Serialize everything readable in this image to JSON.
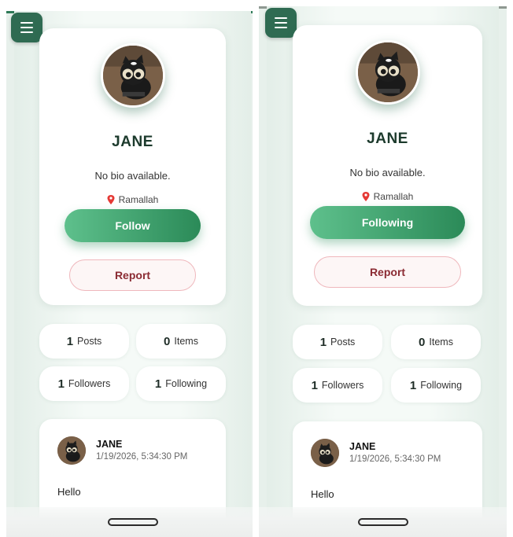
{
  "screens": [
    {
      "profile": {
        "name": "JANE",
        "bio": "No bio available.",
        "location": "Ramallah",
        "follow_label": "Follow",
        "report_label": "Report"
      },
      "stats": {
        "posts": {
          "value": "1",
          "label": "Posts"
        },
        "items": {
          "value": "0",
          "label": "Items"
        },
        "followers": {
          "value": "1",
          "label": "Followers"
        },
        "following": {
          "value": "1",
          "label": "Following"
        }
      },
      "post": {
        "author": "JANE",
        "timestamp": "1/19/2026, 5:34:30 PM",
        "text": "Hello"
      }
    },
    {
      "profile": {
        "name": "JANE",
        "bio": "No bio available.",
        "location": "Ramallah",
        "follow_label": "Following",
        "report_label": "Report"
      },
      "stats": {
        "posts": {
          "value": "1",
          "label": "Posts"
        },
        "items": {
          "value": "0",
          "label": "Items"
        },
        "followers": {
          "value": "1",
          "label": "Followers"
        },
        "following": {
          "value": "1",
          "label": "Following"
        }
      },
      "post": {
        "author": "JANE",
        "timestamp": "1/19/2026, 5:34:30 PM",
        "text": "Hello"
      }
    }
  ],
  "icons": {
    "menu": "menu-icon",
    "location": "location-pin-icon",
    "avatar": "avatar-image"
  },
  "colors": {
    "accent": "#2f6b52",
    "follow_gradient_start": "#5ec08c",
    "follow_gradient_end": "#2b8a58",
    "report_text": "#8b2b33",
    "report_border": "#efb7bc",
    "background": "#e7f0eb"
  }
}
